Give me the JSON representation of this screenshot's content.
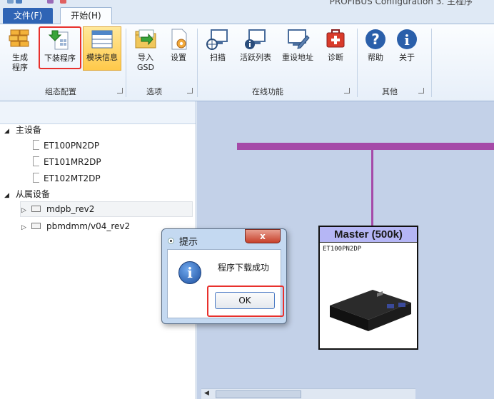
{
  "window": {
    "title": "PROFIBUS Configuration 3. 主程序"
  },
  "ribbon": {
    "tabs": [
      {
        "label": "文件(F)"
      },
      {
        "label": "开始(H)"
      }
    ],
    "groups": {
      "config": {
        "label": "组态配置"
      },
      "options": {
        "label": "选项"
      },
      "online": {
        "label": "在线功能"
      },
      "other": {
        "label": "其他"
      }
    },
    "buttons": {
      "generate": {
        "line1": "生成",
        "line2": "程序"
      },
      "download": {
        "line1": "下装程序"
      },
      "module_info": {
        "line1": "模块信息"
      },
      "import_gsd": {
        "line1": "导入",
        "line2": "GSD"
      },
      "settings": {
        "line1": "设置"
      },
      "scan": {
        "line1": "扫描"
      },
      "active_list": {
        "line1": "活跃列表"
      },
      "reset_address": {
        "line1": "重设地址"
      },
      "diagnose": {
        "line1": "诊断"
      },
      "help": {
        "line1": "帮助"
      },
      "about": {
        "line1": "关于"
      }
    }
  },
  "tree": {
    "master_label": "主设备",
    "masters": [
      "ET100PN2DP",
      "ET101MR2DP",
      "ET102MT2DP"
    ],
    "slave_label": "从属设备",
    "slaves": [
      "mdpb_rev2",
      "pbmdmm/v04_rev2"
    ]
  },
  "canvas": {
    "device_title": "Master (500k)",
    "device_type": "ET100PN2DP"
  },
  "dialog": {
    "title": "提示",
    "close_label": "x",
    "message": "程序下载成功",
    "ok_label": "OK"
  },
  "colors": {
    "bus": "#a54aa8",
    "device_header": "#b5b6f5",
    "highlight_box": "#e8302c",
    "file_tab": "#2f64b5"
  }
}
